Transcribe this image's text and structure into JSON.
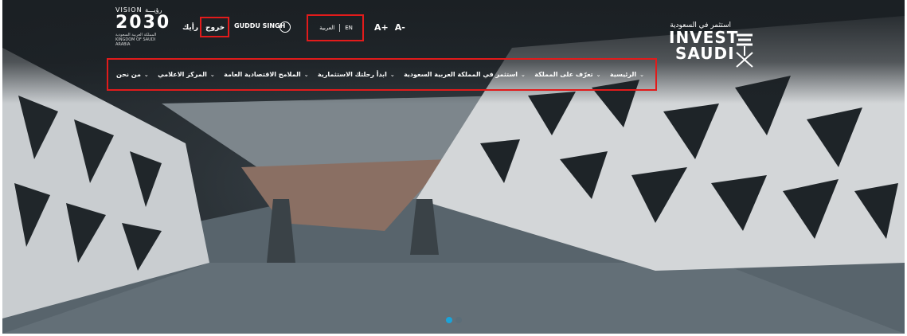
{
  "header": {
    "vision_top": "VISION رؤيـــة",
    "vision_number": "2030",
    "vision_sub": "المملكة العربية السعودية KINGDOM OF SAUDI ARABIA",
    "feedback_link": "رأيك",
    "logout_link": "خروج",
    "user_name": "GUDDU SINGH",
    "lang_arabic": "العربية",
    "lang_en": "EN",
    "font_increase": "A+",
    "font_decrease": "A-",
    "brand_arabic": "استثمر في السعودية",
    "brand_line1": "INVEST",
    "brand_line2": "SAUDI"
  },
  "nav": {
    "items": [
      {
        "label": "الرئيسية"
      },
      {
        "label": "تعرّف على المملكة"
      },
      {
        "label": "استثمر في المملكة العربية السعودية"
      },
      {
        "label": "ابدأ رحلتك الاستثمارية"
      },
      {
        "label": "الملامح الاقتصادية العامة"
      },
      {
        "label": "المركز الاعلامي"
      },
      {
        "label": "من نحن"
      }
    ]
  },
  "carousel": {
    "active_index": 0,
    "count": 2,
    "active_color": "#1aa3d9",
    "inactive_color": "#5b6d78"
  },
  "colors": {
    "highlight": "#e21b1b"
  }
}
